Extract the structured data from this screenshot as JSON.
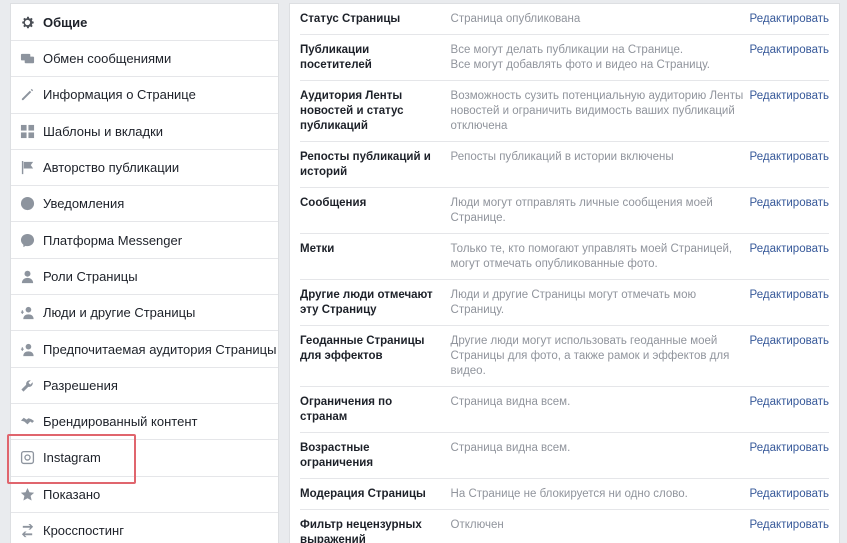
{
  "sidebar": {
    "items": [
      {
        "label": "Общие",
        "icon": "gear-icon"
      },
      {
        "label": "Обмен сообщениями",
        "icon": "chat-icon"
      },
      {
        "label": "Информация о Странице",
        "icon": "pencil-icon"
      },
      {
        "label": "Шаблоны и вкладки",
        "icon": "grid-icon"
      },
      {
        "label": "Авторство публикации",
        "icon": "flag-icon"
      },
      {
        "label": "Уведомления",
        "icon": "globe-icon"
      },
      {
        "label": "Платформа Messenger",
        "icon": "messenger-icon"
      },
      {
        "label": "Роли Страницы",
        "icon": "person-icon"
      },
      {
        "label": "Люди и другие Страницы",
        "icon": "people-icon"
      },
      {
        "label": "Предпочитаемая аудитория Страницы",
        "icon": "audience-icon"
      },
      {
        "label": "Разрешения",
        "icon": "wrench-icon"
      },
      {
        "label": "Брендированный контент",
        "icon": "handshake-icon"
      },
      {
        "label": "Instagram",
        "icon": "instagram-icon"
      },
      {
        "label": "Показано",
        "icon": "star-icon"
      },
      {
        "label": "Кросспостинг",
        "icon": "crosspost-icon"
      }
    ]
  },
  "settings": {
    "edit_label": "Редактировать",
    "rows": [
      {
        "label": "Статус Страницы",
        "desc": "Страница опубликована"
      },
      {
        "label": "Публикации посетителей",
        "desc": "Все могут делать публикации на Странице.\nВсе могут добавлять фото и видео на Страницу."
      },
      {
        "label": "Аудитория Ленты новостей и статус публикаций",
        "desc": "Возможность сузить потенциальную аудиторию Ленты новостей и ограничить видимость ваших публикаций отключена"
      },
      {
        "label": "Репосты публикаций и историй",
        "desc": "Репосты публикаций в истории включены"
      },
      {
        "label": "Сообщения",
        "desc": "Люди могут отправлять личные сообщения моей Странице."
      },
      {
        "label": "Метки",
        "desc": "Только те, кто помогают управлять моей Страницей, могут отмечать опубликованные фото."
      },
      {
        "label": "Другие люди отмечают эту Страницу",
        "desc": "Люди и другие Страницы могут отмечать мою Страницу."
      },
      {
        "label": "Геоданные Страницы для эффектов",
        "desc": "Другие люди могут использовать геоданные моей Страницы для фото, а также рамок и эффектов для видео."
      },
      {
        "label": "Ограничения по странам",
        "desc": "Страница видна всем."
      },
      {
        "label": "Возрастные ограничения",
        "desc": "Страница видна всем."
      },
      {
        "label": "Модерация Страницы",
        "desc": "На Странице не блокируется ни одно слово."
      },
      {
        "label": "Фильтр нецензурных выражений",
        "desc": "Отключен"
      }
    ]
  }
}
